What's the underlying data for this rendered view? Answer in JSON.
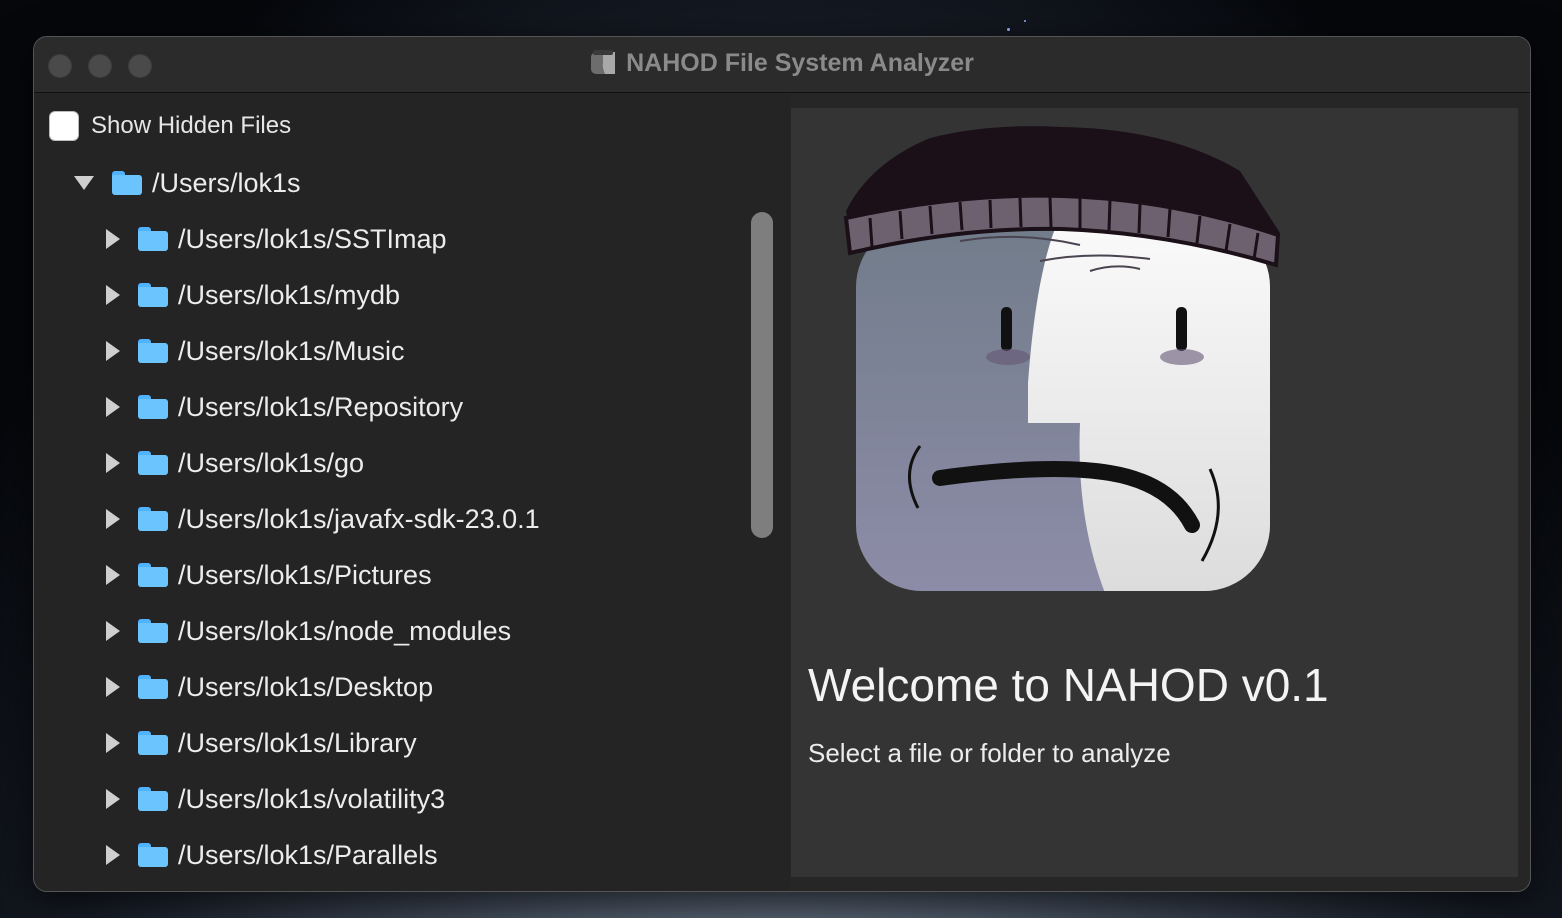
{
  "window": {
    "title": "NAHOD File System Analyzer"
  },
  "sidebar": {
    "show_hidden_label": "Show Hidden Files",
    "show_hidden_checked": false,
    "root": {
      "label": "/Users/lok1s",
      "expanded": true
    },
    "items": [
      {
        "label": "/Users/lok1s/SSTImap"
      },
      {
        "label": "/Users/lok1s/mydb"
      },
      {
        "label": "/Users/lok1s/Music"
      },
      {
        "label": "/Users/lok1s/Repository"
      },
      {
        "label": "/Users/lok1s/go"
      },
      {
        "label": "/Users/lok1s/javafx-sdk-23.0.1"
      },
      {
        "label": "/Users/lok1s/Pictures"
      },
      {
        "label": "/Users/lok1s/node_modules"
      },
      {
        "label": "/Users/lok1s/Desktop"
      },
      {
        "label": "/Users/lok1s/Library"
      },
      {
        "label": "/Users/lok1s/volatility3"
      },
      {
        "label": "/Users/lok1s/Parallels"
      }
    ]
  },
  "main": {
    "welcome": "Welcome to NAHOD v0.1",
    "subtitle": "Select a file or folder to analyze"
  },
  "colors": {
    "folder": "#6cc4ff",
    "window_bg": "#262626",
    "panel_bg": "#343434"
  },
  "icons": {
    "tree_expanded": "triangle-down-icon",
    "tree_collapsed": "triangle-right-icon",
    "folder": "folder-icon"
  }
}
